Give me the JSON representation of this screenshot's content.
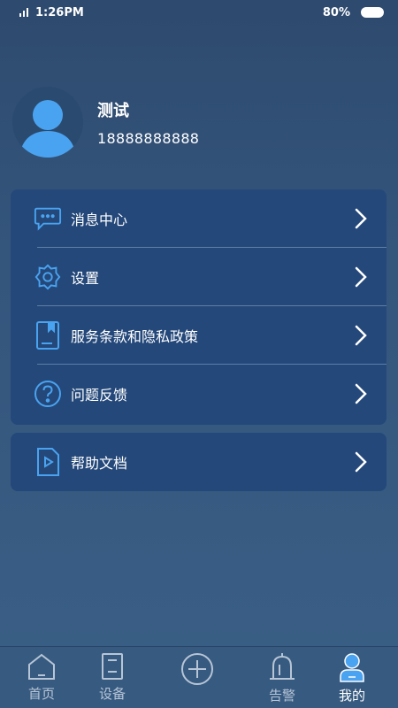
{
  "status_bar": {
    "time": "1:26PM",
    "battery": "80%"
  },
  "profile": {
    "name": "测试",
    "phone": "18888888888"
  },
  "menu": {
    "items": [
      {
        "label": "消息中心",
        "icon": "chat-bubble-icon"
      },
      {
        "label": "设置",
        "icon": "gear-icon"
      },
      {
        "label": "服务条款和隐私政策",
        "icon": "book-icon"
      },
      {
        "label": "问题反馈",
        "icon": "question-icon"
      }
    ],
    "help": {
      "label": "帮助文档",
      "icon": "document-play-icon"
    }
  },
  "tabs": [
    {
      "label": "首页",
      "icon": "home-icon"
    },
    {
      "label": "设备",
      "icon": "device-icon"
    },
    {
      "label": "",
      "icon": "add-circle-icon"
    },
    {
      "label": "告警",
      "icon": "alarm-bell-icon"
    },
    {
      "label": "我的",
      "icon": "user-icon",
      "active": true
    }
  ],
  "colors": {
    "background": "#34557c",
    "card": "#24487a",
    "accent": "#4aa3f0",
    "tab_inactive": "#b7c5d6"
  }
}
